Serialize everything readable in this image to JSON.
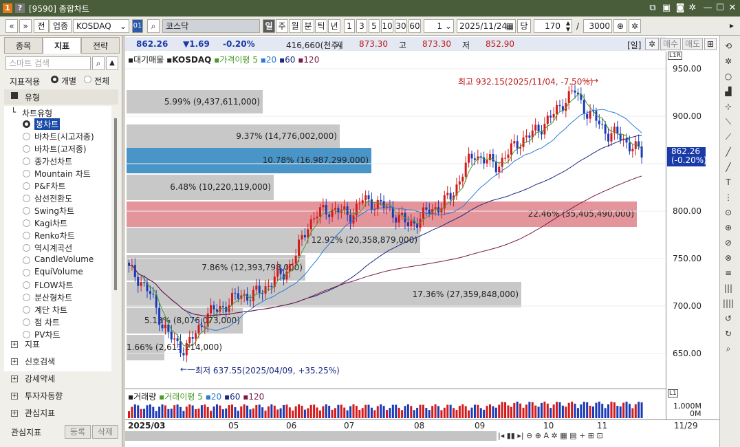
{
  "window": {
    "badge1": "1",
    "badge2": "?",
    "title": "[9590] 종합차트"
  },
  "toolbar": {
    "nav_prev": "«",
    "nav_down": "»",
    "btn_prev": "전",
    "btn_industry": "업종",
    "symbol": "KOSDAQ",
    "btn_01": "01",
    "search_icon": "⌕",
    "market_name": "코스닥",
    "periods": [
      "일",
      "주",
      "월",
      "분",
      "틱",
      "년"
    ],
    "active_period": "일",
    "nums": [
      "1",
      "3",
      "5",
      "10",
      "30",
      "60"
    ],
    "period_value": "1",
    "date": "2025/11/24",
    "btn_current": "당",
    "count": "170",
    "divider": "/",
    "max_count": "3000"
  },
  "left": {
    "tabs": [
      "종목",
      "지표",
      "전략"
    ],
    "active_tab": "지표",
    "search_placeholder": "스마트 검색",
    "apply_label": "지표적용",
    "opt_individual": "개별",
    "opt_all": "전체",
    "sections": [
      "유형",
      "지표",
      "신호검색",
      "강세약세",
      "투자자동향",
      "관심지표"
    ],
    "chart_type_label": "차트유형",
    "items": [
      "봉차트",
      "바차트(시고저종)",
      "바차트(고저종)",
      "종가선차트",
      "Mountain 차트",
      "P&F차트",
      "삼선전환도",
      "Swing차트",
      "Kagi차트",
      "Renko차트",
      "역시계곡선",
      "CandleVolume",
      "EquiVolume",
      "FLOW차트",
      "분산형차트",
      "계단 차트",
      "점 차트",
      "PV차트"
    ],
    "selected_item": "봉차트",
    "footer_label": "관심지표",
    "btn_register": "등록",
    "btn_delete": "삭제"
  },
  "info": {
    "price": "862.26",
    "change": "▼1.69",
    "change_pct": "-0.20%",
    "volume": "416,660(천주)",
    "open_label": "시",
    "open": "873.30",
    "high_label": "고",
    "high": "873.30",
    "low_label": "저",
    "low": "852.90",
    "period_tag": "[일]",
    "btn_buy": "매수",
    "btn_sell": "매도"
  },
  "legend": {
    "vp": "대기매물",
    "index": "KOSDAQ",
    "ma_label": "가격이평",
    "ma": [
      "5",
      "20",
      "60",
      "120"
    ],
    "colors": [
      "#4c9a2a",
      "#2a7ad6",
      "#1a2a80",
      "#7a1a4a"
    ]
  },
  "yaxis": {
    "ticks": [
      "950.00",
      "900.00",
      "850.00",
      "800.00",
      "750.00",
      "700.00",
      "650.00"
    ],
    "current": "862.26",
    "current_pct": "(-0.20%)",
    "unit_tag": "L1R"
  },
  "annotations": {
    "high": "최고 932.15(2025/11/04, -7.50%)",
    "low": "최저 637.55(2025/04/09, +35.25%)"
  },
  "volume_profile": [
    {
      "label": "5.99% (9,437,611,000)",
      "pct": 5.99,
      "color": "#c8c8c8"
    },
    {
      "label": "9.37% (14,776,002,000)",
      "pct": 9.37,
      "color": "#c8c8c8"
    },
    {
      "label": "10.78% (16,987,299,000)",
      "pct": 10.78,
      "color": "#4a95c8"
    },
    {
      "label": "6.48% (10,220,119,000)",
      "pct": 6.48,
      "color": "#c8c8c8"
    },
    {
      "label": "22.46% (35,405,490,000)",
      "pct": 22.46,
      "color": "#e4959c"
    },
    {
      "label": "12.92% (20,358,879,000)",
      "pct": 12.92,
      "color": "#c8c8c8"
    },
    {
      "label": "7.86% (12,393,798,000)",
      "pct": 7.86,
      "color": "#c8c8c8"
    },
    {
      "label": "17.36% (27,359,848,000)",
      "pct": 17.36,
      "color": "#c8c8c8"
    },
    {
      "label": "5.13% (8,076,073,000)",
      "pct": 5.13,
      "color": "#c8c8c8"
    },
    {
      "label": "1.66% (2,613,214,000)",
      "pct": 1.66,
      "color": "#c8c8c8"
    }
  ],
  "volume_panel": {
    "title": "거래량",
    "ma_label": "거래이평",
    "ma": [
      "5",
      "20",
      "60",
      "120"
    ],
    "ticks": [
      "1,000M",
      "0M"
    ],
    "unit_tag": "L1"
  },
  "xaxis": {
    "labels": [
      "2025/03",
      "05",
      "06",
      "07",
      "08",
      "09",
      "10",
      "11"
    ],
    "last": "11/29"
  },
  "chart_data": {
    "type": "candlestick",
    "ylim": [
      625,
      965
    ],
    "series_close_approx": [
      745,
      735,
      718,
      690,
      672,
      665,
      680,
      700,
      705,
      712,
      720,
      718,
      725,
      735,
      742,
      760,
      790,
      802,
      806,
      803,
      800,
      816,
      812,
      808,
      800,
      790,
      796,
      805,
      810,
      820,
      845,
      862,
      855,
      850,
      862,
      875,
      880,
      890,
      900,
      915,
      925,
      905,
      895,
      882,
      880,
      870,
      862
    ]
  }
}
